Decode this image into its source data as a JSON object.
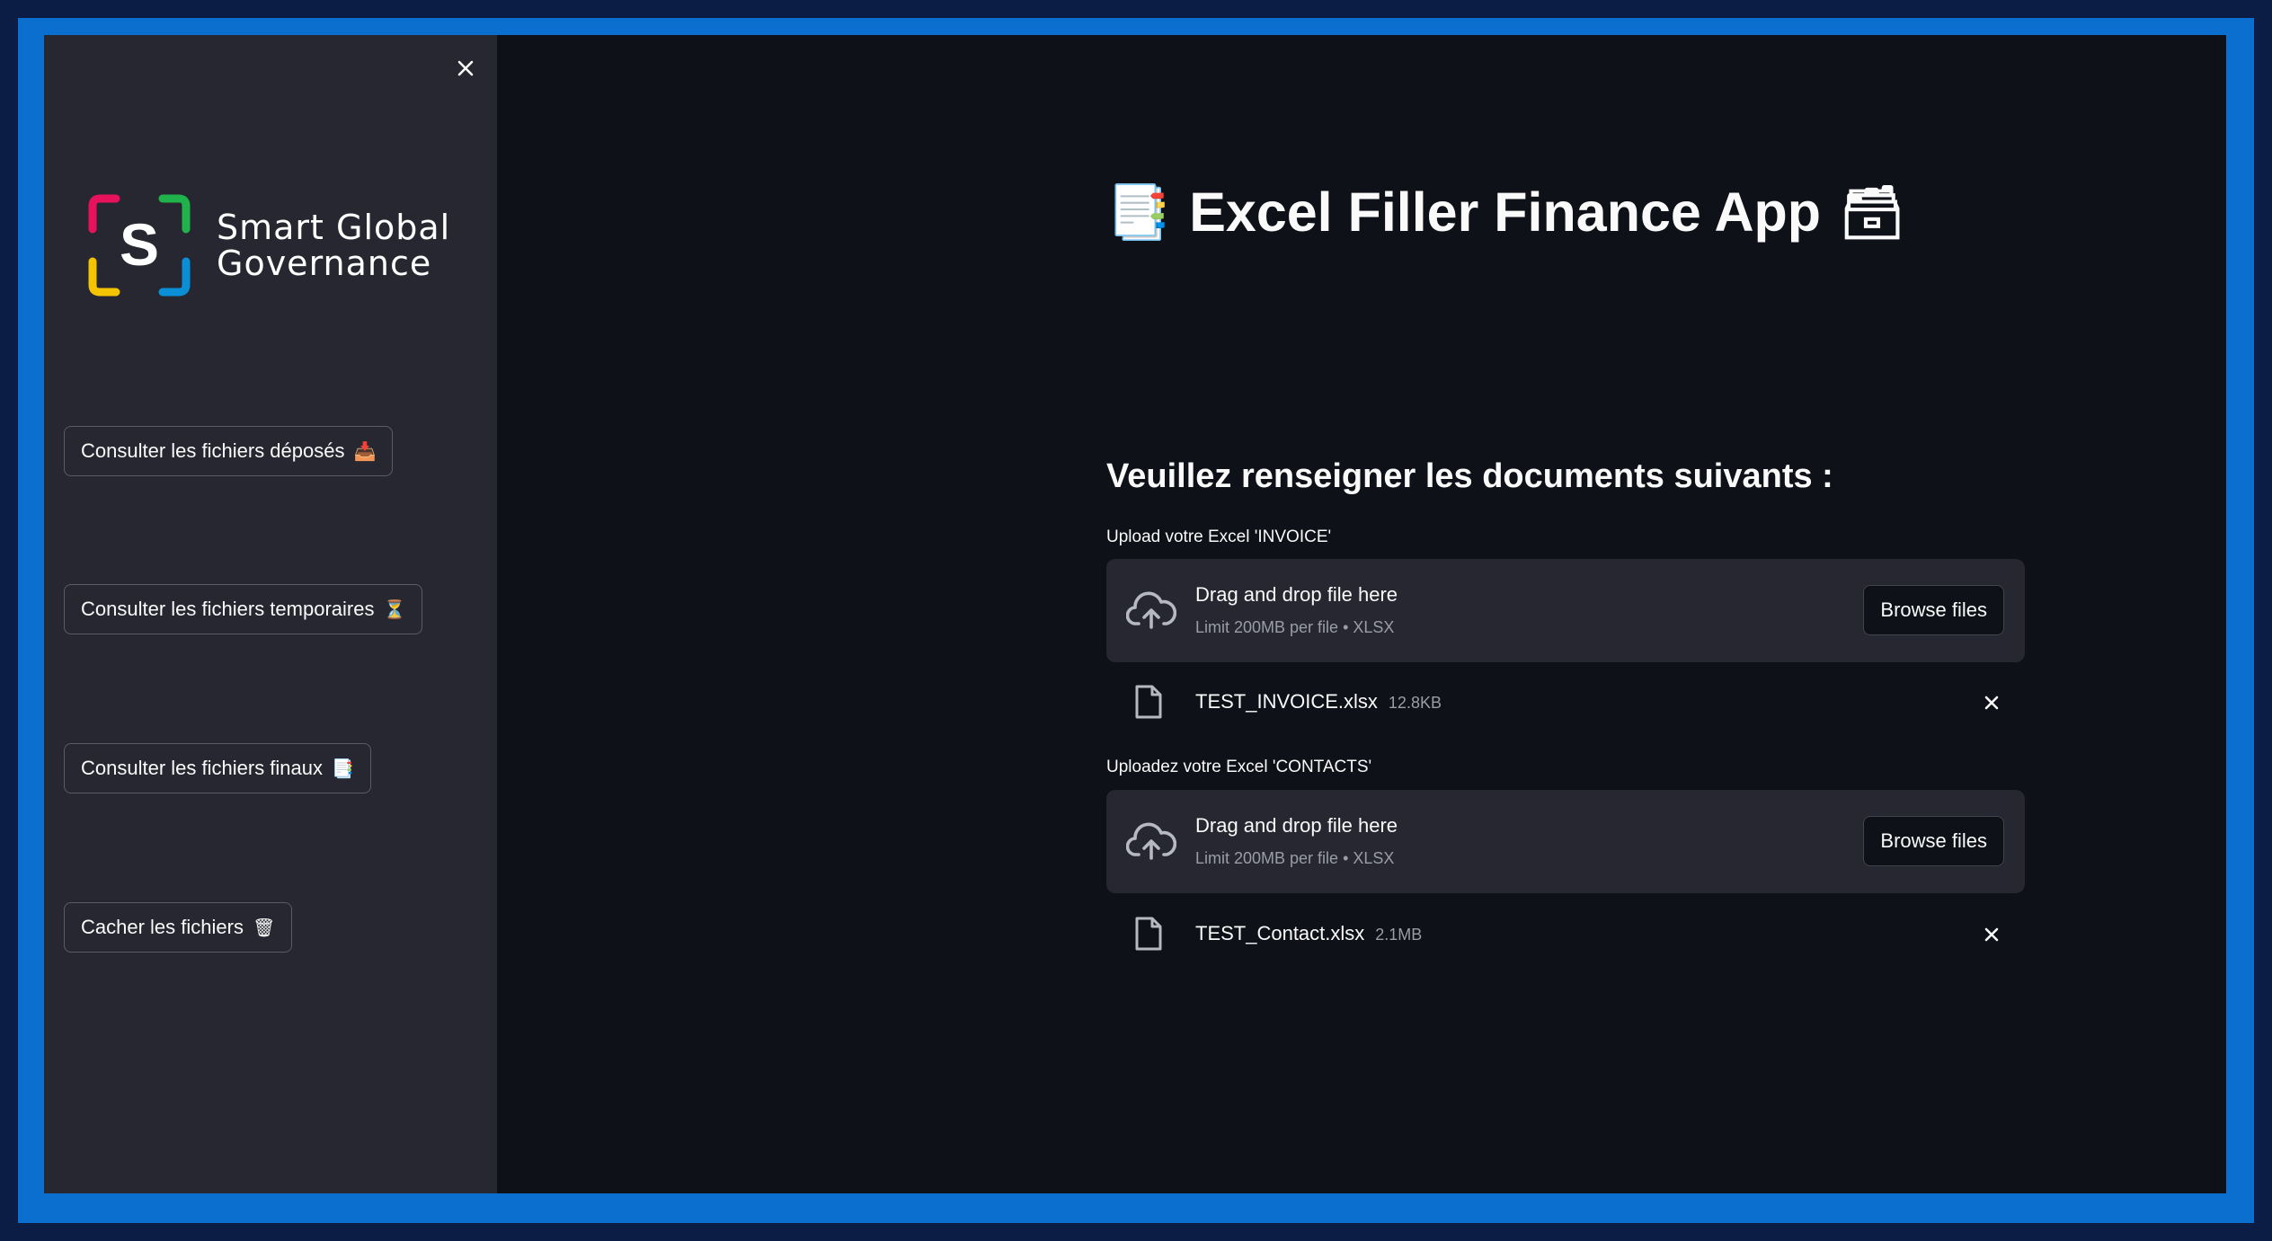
{
  "sidebar": {
    "logo": {
      "line1": "Smart Global",
      "line2": "Governance",
      "letter": "S"
    },
    "buttons": [
      {
        "label": "Consulter les fichiers déposés",
        "emoji": "📥"
      },
      {
        "label": "Consulter les fichiers temporaires",
        "emoji": "⏳"
      },
      {
        "label": "Consulter les fichiers finaux",
        "emoji": "📑"
      },
      {
        "label": "Cacher les fichiers",
        "emoji": "🗑"
      }
    ],
    "close_icon": "close-icon"
  },
  "main": {
    "title": "Excel Filler Finance App",
    "title_emoji_left": "📑",
    "title_emoji_right": "🗃",
    "subheading": "Veuillez renseigner les documents suivants :",
    "uploaders": [
      {
        "label": "Upload votre Excel 'INVOICE'",
        "dropzone_title": "Drag and drop file here",
        "dropzone_limit": "Limit 200MB per file • XLSX",
        "browse_label": "Browse files",
        "file": {
          "name": "TEST_INVOICE.xlsx",
          "size": "12.8KB"
        }
      },
      {
        "label": "Uploadez votre Excel 'CONTACTS'",
        "dropzone_title": "Drag and drop file here",
        "dropzone_limit": "Limit 200MB per file • XLSX",
        "browse_label": "Browse files",
        "file": {
          "name": "TEST_Contact.xlsx",
          "size": "2.1MB"
        }
      }
    ]
  },
  "colors": {
    "frame": "#0a6fcf",
    "outer_background": "#0b1d45",
    "app_background": "#0e1117",
    "sidebar_background": "#262730",
    "logo_accents": [
      "#e8115b",
      "#20b24b",
      "#0a8fd6",
      "#f5c400"
    ]
  }
}
